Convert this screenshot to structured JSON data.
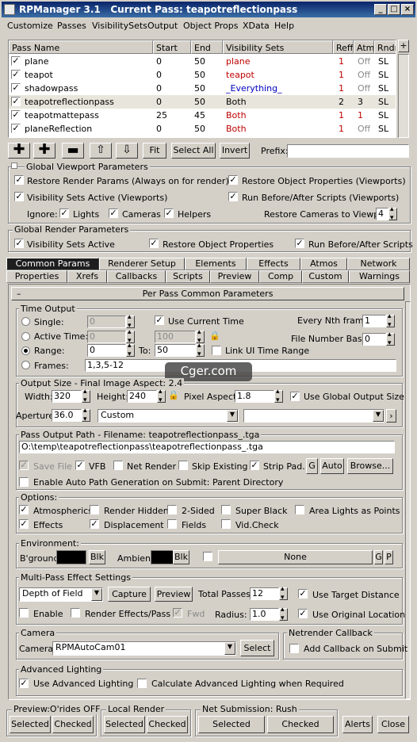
{
  "window": {
    "title": "RPManager 3.1",
    "current_pass_label": "Current Pass: teapotreflectionpass"
  },
  "menu": [
    "Customize",
    "Passes",
    "VisibilitySets",
    "Output",
    "Object Props",
    "XData",
    "Help"
  ],
  "table": {
    "columns": [
      "Pass Name",
      "Start",
      "End",
      "Visibility Sets",
      "Reff",
      "Atm",
      "Rndr"
    ],
    "rows": [
      {
        "name": "plane",
        "start": "0",
        "end": "50",
        "vis": "plane",
        "reff": "1",
        "atm": "Off",
        "rndr": "SL"
      },
      {
        "name": "teapot",
        "start": "0",
        "end": "50",
        "vis": "teapot",
        "reff": "1",
        "atm": "Off",
        "rndr": "SL"
      },
      {
        "name": "shadowpass",
        "start": "0",
        "end": "50",
        "vis": "_Everything_",
        "reff": "1",
        "atm": "Off",
        "rndr": "SL"
      },
      {
        "name": "teapotreflectionpass",
        "start": "0",
        "end": "50",
        "vis": "Both",
        "reff": "2",
        "atm": "3",
        "rndr": "SL"
      },
      {
        "name": "teapotmattepass",
        "start": "25",
        "end": "45",
        "vis": "Both",
        "reff": "1",
        "atm": "1",
        "rndr": "SL"
      },
      {
        "name": "planeReflection",
        "start": "0",
        "end": "50",
        "vis": "Both",
        "reff": "1",
        "atm": "Off",
        "rndr": "SL"
      }
    ],
    "plus_label": "+"
  },
  "toolbar": {
    "fit": "Fit",
    "select_all": "Select All",
    "invert": "Invert",
    "prefix_label": "Prefix:"
  },
  "viewport": {
    "title": "Global Viewport Parameters",
    "restore_render": "Restore Render Params (Always on for render)",
    "restore_object": "Restore Object Properties (Viewports)",
    "vis_sets_active": "Visibility Sets Active (Viewports)",
    "run_scripts": "Run Before/After Scripts (Viewports)",
    "ignore": "Ignore:",
    "lights": "Lights",
    "cameras": "Cameras",
    "helpers": "Helpers",
    "restore_cameras": "Restore Cameras to Viewport:",
    "restore_cameras_value": "4"
  },
  "render_params": {
    "title": "Global Render Parameters",
    "vis_sets_active": "Visibility Sets Active",
    "restore_object": "Restore Object Properties",
    "run_scripts": "Run Before/After Scripts"
  },
  "tabs_row1": [
    "Common Params",
    "Renderer Setup",
    "Elements",
    "Effects",
    "Atmos",
    "Network"
  ],
  "tabs_row2": [
    "Properties",
    "Xrefs",
    "Callbacks",
    "Scripts",
    "Preview",
    "Comp",
    "Custom",
    "Warnings"
  ],
  "rollout": {
    "minus": "–",
    "title": "Per Pass Common Parameters"
  },
  "time_output": {
    "title": "Time Output",
    "single": "Single:",
    "single_val": "0",
    "use_current_time": "Use Current Time",
    "every_nth": "Every Nth frame:",
    "every_nth_val": "1",
    "active_time": "Active Time:",
    "active_a": "0",
    "active_b": "100",
    "file_number_base": "File Number Base:",
    "file_number_base_val": "0",
    "range": "Range:",
    "range_from": "0",
    "to": "To:",
    "range_to": "50",
    "link_ui": "Link UI Time Range",
    "frames": "Frames:",
    "frames_val": "1,3,5-12"
  },
  "watermark": "Cger.com",
  "output_size": {
    "title": "Output Size - Final Image Aspect: 2.4",
    "width_label": "Width:",
    "width": "320",
    "height_label": "Height:",
    "height": "240",
    "pixel_aspect_label": "Pixel Aspect:",
    "pixel_aspect": "1.8",
    "use_global": "Use Global Output Size",
    "aperture_label": "Aperture:",
    "aperture": "36.0",
    "preset": "Custom"
  },
  "output_path": {
    "title": "Pass Output Path - Filename: teapotreflectionpass_.tga",
    "path": "O:\\temp\\teapotreflectionpass\\teapotreflectionpass_.tga",
    "save_file": "Save File",
    "vfb": "VFB",
    "net_render": "Net Render",
    "skip_existing": "Skip Existing",
    "strip_pad": "Strip Pad.",
    "g": "G",
    "auto": "Auto",
    "browse": "Browse...",
    "enable_auto": "Enable Auto Path Generation on Submit: Parent Directory"
  },
  "options": {
    "title": "Options:",
    "atmospherics": "Atmospherics",
    "render_hidden": "Render Hidden",
    "two_sided": "2-Sided",
    "super_black": "Super Black",
    "area_lights": "Area Lights as Points",
    "effects": "Effects",
    "displacement": "Displacement",
    "fields": "Fields",
    "vid_check": "Vid.Check"
  },
  "environment": {
    "title": "Environment:",
    "bground": "B'ground",
    "blk1": "Blk",
    "ambient": "Ambient",
    "blk2": "Blk",
    "none": "None",
    "g": "G",
    "p": "P"
  },
  "multipass": {
    "title": "Multi-Pass Effect Settings",
    "effect": "Depth of Field",
    "capture": "Capture",
    "preview": "Preview",
    "total_passes_label": "Total Passes:",
    "total_passes": "12",
    "use_target_distance": "Use Target Distance",
    "enable": "Enable",
    "render_effects": "Render Effects/Pass",
    "fwd": "Fwd",
    "radius_label": "Radius:",
    "radius": "1.0",
    "use_original_location": "Use Original Location"
  },
  "camera": {
    "title": "Camera",
    "label": "Camera:",
    "value": "RPMAutoCam01",
    "select": "Select"
  },
  "netrender": {
    "title": "Netrender Callback",
    "add": "Add Callback on Submit"
  },
  "lighting": {
    "title": "Advanced Lighting",
    "use": "Use Advanced Lighting",
    "calc": "Calculate Advanced Lighting when Required"
  },
  "bottom": {
    "preview_title": "Preview:O'rides OFF",
    "local_title": "Local Render",
    "net_title": "Net Submission: Rush",
    "selected": "Selected",
    "checked": "Checked",
    "alerts": "Alerts",
    "close": "Close"
  }
}
